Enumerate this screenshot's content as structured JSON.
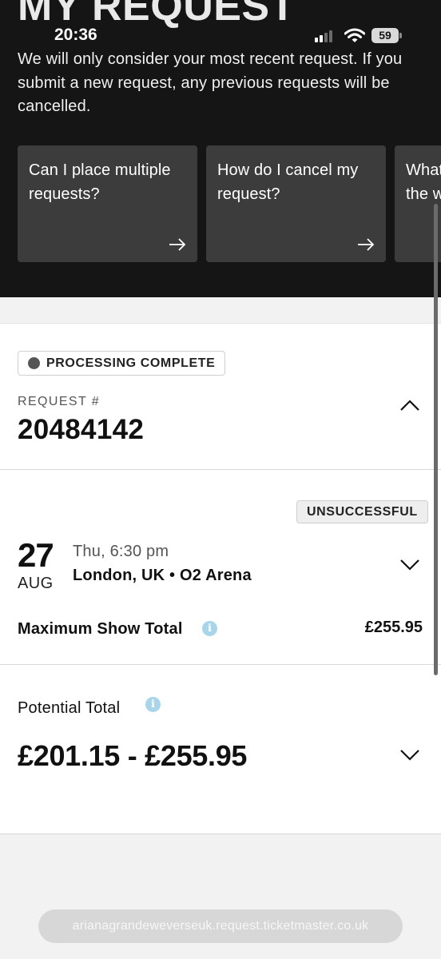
{
  "header": {
    "title": "MY REQUEST",
    "description": "We will only consider your most recent request. If you submit a new request, any previous requests will be cancelled."
  },
  "status_bar": {
    "time": "20:36",
    "battery": "59"
  },
  "faq_cards": [
    {
      "question": "Can I place multiple requests?"
    },
    {
      "question": "How do I cancel my request?"
    },
    {
      "question": "What happens once the window"
    }
  ],
  "request": {
    "status_badge": "PROCESSING COMPLETE",
    "number_label": "REQUEST #",
    "number": "20484142"
  },
  "event": {
    "result_badge": "UNSUCCESSFUL",
    "day": "27",
    "month": "AUG",
    "time": "Thu, 6:30 pm",
    "venue": "London, UK • O2 Arena",
    "max_total_label": "Maximum Show Total",
    "max_total_value": "£255.95"
  },
  "potential": {
    "label": "Potential Total",
    "value": "£201.15 - £255.95"
  },
  "browser": {
    "url": "arianagrandeweverseuk.request.ticketmaster.co.uk"
  },
  "colors": {
    "header_bg": "#151515",
    "card_bg": "#3c3c3c",
    "info_icon": "#a9d5ea"
  }
}
